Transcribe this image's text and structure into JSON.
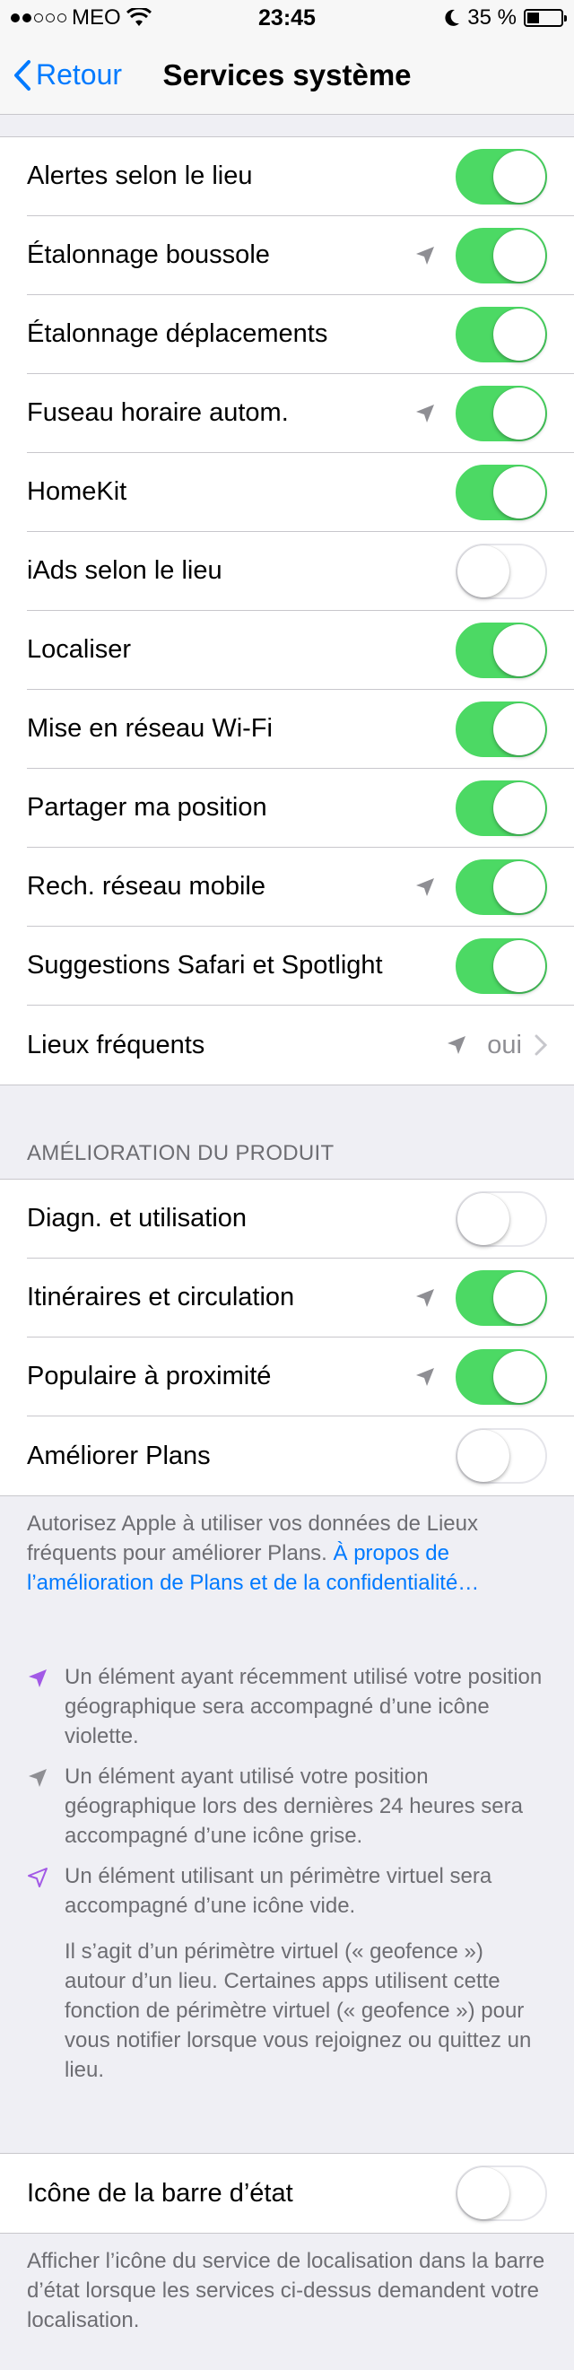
{
  "status_bar": {
    "carrier": "MEO",
    "time": "23:45",
    "battery": "35 %",
    "battery_level": 0.35
  },
  "nav": {
    "back_label": "Retour",
    "title": "Services système"
  },
  "main_items": [
    {
      "label": "Alertes selon le lieu",
      "arrow": false,
      "on": true
    },
    {
      "label": "Étalonnage boussole",
      "arrow": true,
      "on": true
    },
    {
      "label": "Étalonnage déplacements",
      "arrow": false,
      "on": true
    },
    {
      "label": "Fuseau horaire autom.",
      "arrow": true,
      "on": true
    },
    {
      "label": "HomeKit",
      "arrow": false,
      "on": true
    },
    {
      "label": "iAds selon le lieu",
      "arrow": false,
      "on": false
    },
    {
      "label": "Localiser",
      "arrow": false,
      "on": true
    },
    {
      "label": "Mise en réseau Wi-Fi",
      "arrow": false,
      "on": true
    },
    {
      "label": "Partager ma position",
      "arrow": false,
      "on": true
    },
    {
      "label": "Rech. réseau mobile",
      "arrow": true,
      "on": true
    },
    {
      "label": "Suggestions Safari et Spotlight",
      "arrow": false,
      "on": true
    }
  ],
  "frequent": {
    "label": "Lieux fréquents",
    "value": "oui"
  },
  "product_section": {
    "header": "AMÉLIORATION DU PRODUIT",
    "items": [
      {
        "label": "Diagn. et utilisation",
        "arrow": false,
        "on": false
      },
      {
        "label": "Itinéraires et circulation",
        "arrow": true,
        "on": true
      },
      {
        "label": "Populaire à proximité",
        "arrow": true,
        "on": true
      },
      {
        "label": "Améliorer Plans",
        "arrow": false,
        "on": false
      }
    ],
    "footer_text": "Autorisez Apple à utiliser vos données de Lieux fréquents pour améliorer Plans.",
    "footer_link": "À propos de l’amélioration de Plans et de la confidentialité…"
  },
  "legend": {
    "purple": "Un élément ayant récemment utilisé votre position géographique sera accompagné d’une icône violette.",
    "gray": "Un élément ayant utilisé votre position géographique lors des dernières 24 heures sera accompagné d’une icône grise.",
    "outline": "Un élément utilisant un périmètre virtuel sera accompagné d’une icône vide.",
    "note": "Il s’agit d’un périmètre virtuel (« geofence ») autour d’un lieu. Certaines apps utilisent cette fonction de périmètre virtuel (« geofence ») pour vous notifier lorsque vous rejoignez ou quittez un lieu."
  },
  "status_icon_section": {
    "label": "Icône de la barre d’état",
    "on": false,
    "footer": "Afficher l’icône du service de localisation dans la barre d’état lorsque les services ci-dessus demandent votre localisation."
  },
  "colors": {
    "accent": "#007aff",
    "toggle_on": "#4cd964",
    "arrow_gray": "#8e8e93",
    "arrow_purple": "#a259e6"
  },
  "icons": {
    "location_arrow": "location-arrow-icon",
    "chevron": "chevron-right-icon",
    "back": "chevron-left-icon"
  }
}
